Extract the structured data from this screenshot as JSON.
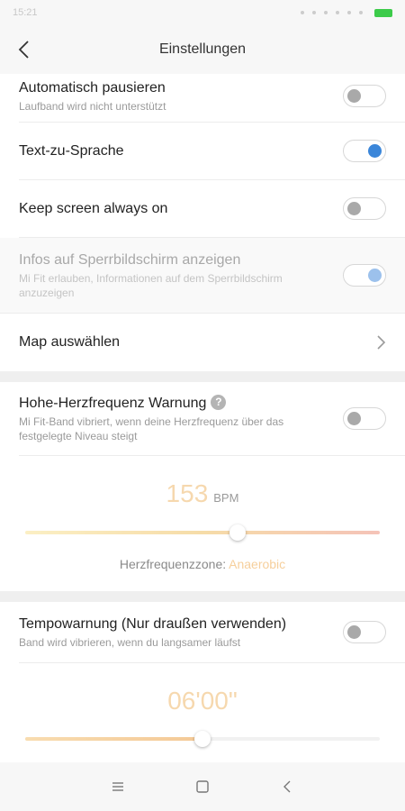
{
  "status_bar": {
    "time": "15:21"
  },
  "header": {
    "title": "Einstellungen"
  },
  "settings": {
    "auto_pause": {
      "label": "Automatisch pausieren",
      "sub": "Laufband wird nicht unterstützt",
      "on": false
    },
    "tts": {
      "label": "Text-zu-Sprache",
      "on": true
    },
    "keep_screen": {
      "label": "Keep screen always on",
      "on": false
    },
    "lockscreen": {
      "label": "Infos auf Sperrbildschirm anzeigen",
      "sub": "Mi Fit erlauben, Informationen auf dem Sperrbildschirm anzuzeigen",
      "on": true,
      "disabled": true
    },
    "map": {
      "label": "Map auswählen"
    }
  },
  "heart_rate": {
    "label": "Hohe-Herzfrequenz Warnung",
    "help_icon": "?",
    "sub": "Mi Fit-Band vibriert, wenn deine Herzfrequenz über das festgelegte Niveau steigt",
    "on": false,
    "value": "153",
    "unit": "BPM",
    "slider_fraction": 0.6,
    "zone_label": "Herzfrequenzzone:",
    "zone_value": "Anaerobic"
  },
  "pace": {
    "label": "Tempowarnung (Nur draußen verwenden)",
    "sub": "Band wird vibrieren, wenn du langsamer läufst",
    "on": false,
    "value": "06'00\"",
    "slider_fraction": 0.5
  },
  "colors": {
    "accent": "#3b86d9",
    "value_orange": "#f6d8ae",
    "toggle_off": "#a9a9a9"
  }
}
